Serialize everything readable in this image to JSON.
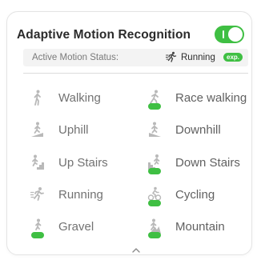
{
  "card": {
    "title": "Adaptive Motion Recognition",
    "toggle_on": true
  },
  "status": {
    "label": "Active Motion Status:",
    "value": "Running",
    "badge": "exp."
  },
  "modes": [
    {
      "label": "Walking",
      "icon": "walking-icon",
      "exp": false
    },
    {
      "label": "Race walking",
      "icon": "race-walking-icon",
      "exp": true
    },
    {
      "label": "Uphill",
      "icon": "uphill-icon",
      "exp": false
    },
    {
      "label": "Downhill",
      "icon": "downhill-icon",
      "exp": false
    },
    {
      "label": "Up Stairs",
      "icon": "up-stairs-icon",
      "exp": false
    },
    {
      "label": "Down Stairs",
      "icon": "down-stairs-icon",
      "exp": true
    },
    {
      "label": "Running",
      "icon": "running-icon",
      "exp": false
    },
    {
      "label": "Cycling",
      "icon": "cycling-icon",
      "exp": true
    },
    {
      "label": "Gravel",
      "icon": "gravel-icon",
      "exp": true
    },
    {
      "label": "Mountain",
      "icon": "mountain-icon",
      "exp": true
    }
  ],
  "colors": {
    "accent": "#3fbf43",
    "icon": "#b9b9b9",
    "text": "#727272"
  },
  "footer": {
    "icon": "chevron-up-icon"
  }
}
